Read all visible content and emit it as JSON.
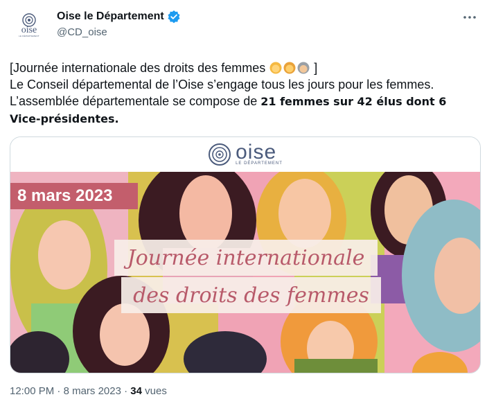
{
  "account": {
    "name": "Oise le Département",
    "handle": "@CD_oise",
    "verified": true,
    "avatar_text": "oise",
    "avatar_sub": "LE DÉPARTEMENT"
  },
  "tweet": {
    "line1_prefix": "[Journée internationale des droits des femmes",
    "line1_suffix": "]",
    "emojis": [
      "woman-emoji",
      "woman-emoji",
      "older-woman-emoji"
    ],
    "body_plain": "Le Conseil départemental de l’Oise s’engage tous les jours pour les femmes. L’assemblée départementale se compose de ",
    "body_bold": "21 femmes sur 42 élus dont 6 Vice-présidentes",
    "body_end": "."
  },
  "media": {
    "brand_word": "oise",
    "brand_sub": "LE DÉPARTEMENT",
    "date_badge": "8 mars 2023",
    "title_line1": "Journée internationale",
    "title_line2": "des droits des femmes",
    "colors": {
      "badge": "#c35e6c",
      "script": "#b85a6a",
      "brand": "#4b5b7c"
    }
  },
  "footer": {
    "time": "12:00 PM",
    "sep1": "·",
    "date": "8 mars 2023",
    "sep2": "·",
    "views_count": "34",
    "views_label": "vues"
  }
}
